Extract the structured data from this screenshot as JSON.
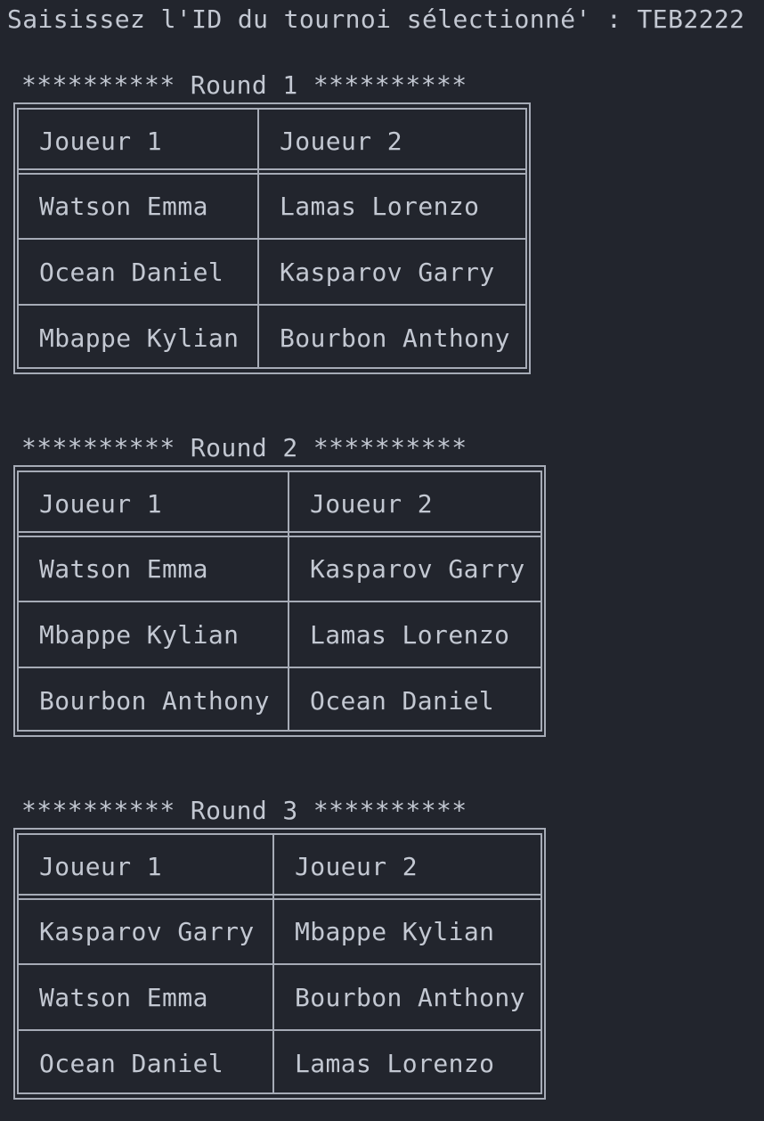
{
  "prompt": "Saisissez l'ID du tournoi sélectionné' : TEB2222",
  "rounds": [
    {
      "title": "********** Round 1 **********",
      "headers": [
        "Joueur 1",
        "Joueur 2"
      ],
      "rows": [
        [
          "Watson Emma",
          "Lamas Lorenzo"
        ],
        [
          "Ocean Daniel",
          "Kasparov Garry"
        ],
        [
          "Mbappe Kylian",
          "Bourbon Anthony"
        ]
      ]
    },
    {
      "title": "********** Round 2 **********",
      "headers": [
        "Joueur 1",
        "Joueur 2"
      ],
      "rows": [
        [
          "Watson Emma",
          "Kasparov Garry"
        ],
        [
          "Mbappe Kylian",
          "Lamas Lorenzo"
        ],
        [
          "Bourbon Anthony",
          "Ocean Daniel"
        ]
      ]
    },
    {
      "title": "********** Round 3 **********",
      "headers": [
        "Joueur 1",
        "Joueur 2"
      ],
      "rows": [
        [
          "Kasparov Garry",
          "Mbappe Kylian"
        ],
        [
          "Watson Emma",
          "Bourbon Anthony"
        ],
        [
          "Ocean Daniel",
          "Lamas Lorenzo"
        ]
      ]
    }
  ]
}
